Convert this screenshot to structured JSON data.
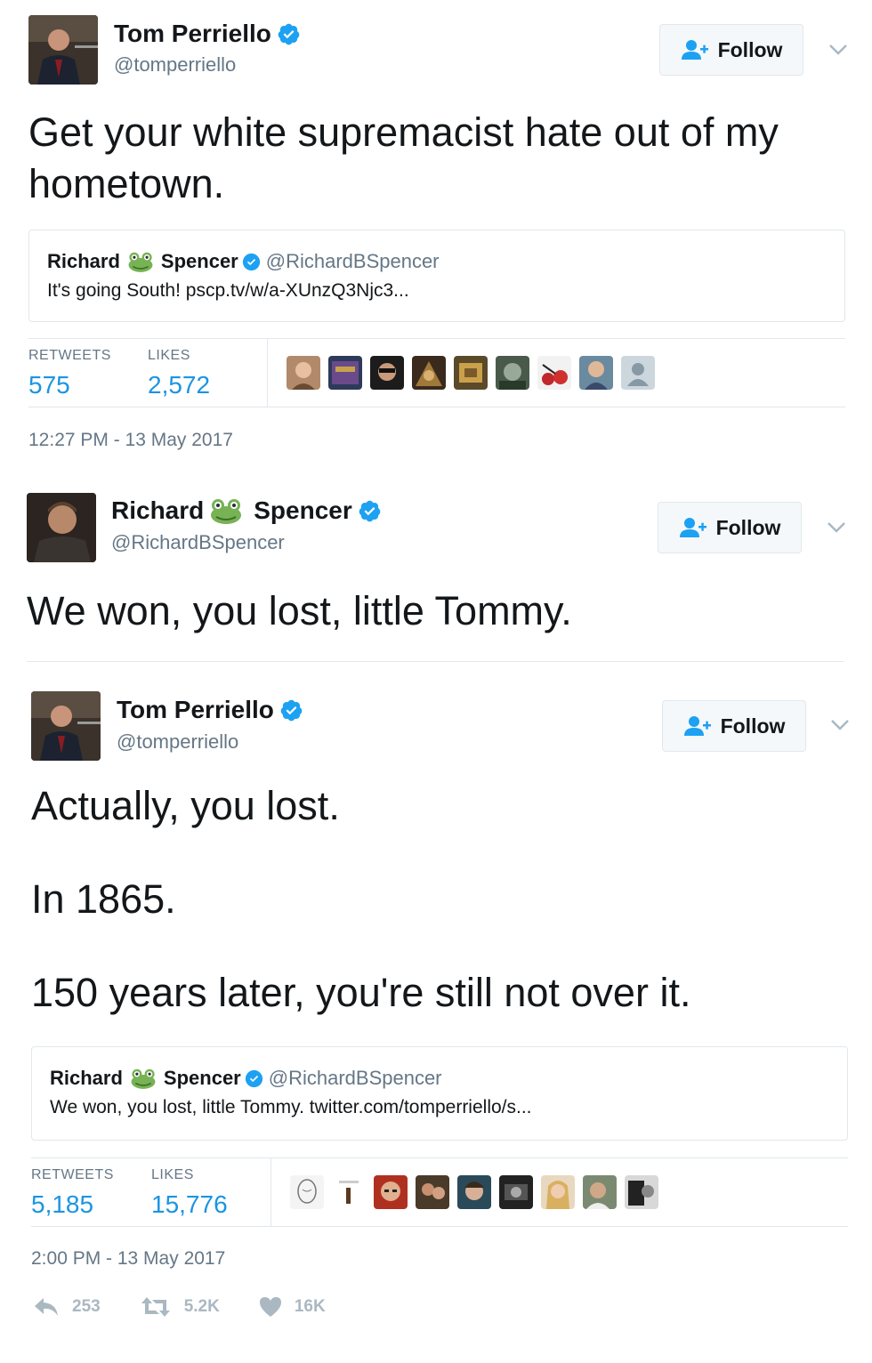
{
  "tweets": [
    {
      "author": {
        "first": "Tom Perriello",
        "last": "",
        "handle": "@tomperriello"
      },
      "follow_label": "Follow",
      "text": "Get your white supremacist hate out of my\nhometown.",
      "quote": {
        "name_first": "Richard",
        "name_last": "Spencer",
        "handle": "@RichardBSpencer",
        "text": "It's going South! pscp.tv/w/a-XUnzQ3Njc3..."
      },
      "retweets_label": "RETWEETS",
      "retweets": "575",
      "likes_label": "LIKES",
      "likes": "2,572",
      "timestamp": "12:27 PM - 13 May 2017"
    },
    {
      "author": {
        "first": "Richard",
        "last": "Spencer",
        "handle": "@RichardBSpencer"
      },
      "follow_label": "Follow",
      "text": "We won, you lost, little Tommy."
    },
    {
      "author": {
        "first": "Tom Perriello",
        "last": "",
        "handle": "@tomperriello"
      },
      "follow_label": "Follow",
      "text": "Actually, you lost.\n\nIn 1865.\n\n150 years later, you're still not over it.",
      "quote": {
        "name_first": "Richard",
        "name_last": "Spencer",
        "handle": "@RichardBSpencer",
        "text": "We won, you lost, little Tommy. twitter.com/tomperriello/s..."
      },
      "retweets_label": "RETWEETS",
      "retweets": "5,185",
      "likes_label": "LIKES",
      "likes": "15,776",
      "timestamp": "2:00 PM - 13 May 2017",
      "actions": {
        "replies": "253",
        "retweets": "5.2K",
        "likes": "16K"
      }
    }
  ],
  "colors": {
    "text": "#14171a",
    "secondary": "#657786",
    "link": "#1b95e0",
    "verified": "#1da1f2",
    "border": "#e1e8ed",
    "action_icon": "#aab8c2"
  },
  "icons": [
    "verified-badge-icon",
    "frog-emoji-icon",
    "follow-person-icon",
    "chevron-down-icon",
    "reply-icon",
    "retweet-icon",
    "heart-icon"
  ]
}
